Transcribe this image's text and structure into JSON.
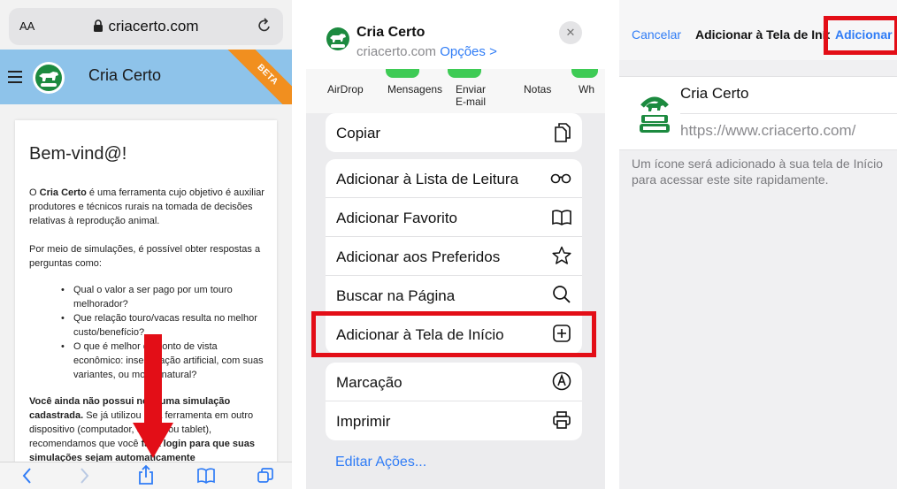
{
  "colors": {
    "accent": "#2f7cf6",
    "highlight": "#e30e17",
    "appbar": "#8ec3ea",
    "beta": "#f18f1f",
    "brand_green": "#1c8a3f"
  },
  "safari": {
    "aa_label": "AA",
    "url": "criacerto.com",
    "app_title": "Cria Certo",
    "beta_label": "BETA",
    "welcome": "Bem-vind@!",
    "p1_brand": "Cria Certo",
    "p1_text": " é uma ferramenta cujo objetivo é auxiliar produtores e técnicos rurais na tomada de decisões relativas à reprodução animal.",
    "p1_prefix": "O ",
    "p2": "Por meio de simulações, é possível obter respostas a perguntas como:",
    "bullets": [
      "Qual o valor a ser pago por um touro melhorador?",
      "Que relação touro/vacas resulta no melhor custo/benefício?",
      "O que é melhor do ponto de vista econômico: inseminação artificial, com suas variantes, ou monta natural?"
    ],
    "p3_bold": "Você ainda não possui nenhuma simulação cadastrada.",
    "p3_text1": " Se já utilizou esta ferramenta em outro dispositivo (computador, celular ou tablet), recomendamos que você ",
    "p3_bold2": "faça login para que suas simulações sejam automaticamente",
    "bottom_icons": [
      "back-icon",
      "forward-icon",
      "share-icon",
      "bookmarks-icon",
      "tabs-icon"
    ]
  },
  "share_sheet": {
    "title": "Cria Certo",
    "domain": "criacerto.com",
    "options_label": "Opções >",
    "close_label": "✕",
    "apps": [
      "AirDrop",
      "Mensagens",
      "Enviar E-mail",
      "Notas",
      "Wh"
    ],
    "actions_group1": [
      {
        "label": "Copiar",
        "icon": "copy-icon"
      }
    ],
    "actions_group2": [
      {
        "label": "Adicionar à Lista de Leitura",
        "icon": "glasses-icon"
      },
      {
        "label": "Adicionar Favorito",
        "icon": "book-icon"
      },
      {
        "label": "Adicionar aos Preferidos",
        "icon": "star-icon"
      },
      {
        "label": "Buscar na Página",
        "icon": "search-icon"
      },
      {
        "label": "Adicionar à Tela de Início",
        "icon": "add-square-icon"
      }
    ],
    "actions_group3": [
      {
        "label": "Marcação",
        "icon": "markup-icon"
      },
      {
        "label": "Imprimir",
        "icon": "print-icon"
      }
    ],
    "edit_label": "Editar Ações..."
  },
  "add_home": {
    "cancel_label": "Cancelar",
    "title": "Adicionar à Tela de Início",
    "add_label": "Adicionar",
    "name_value": "Cria Certo",
    "url_value": "https://www.criacerto.com/",
    "note": "Um ícone será adicionado à sua tela de Início para acessar este site rapidamente."
  }
}
